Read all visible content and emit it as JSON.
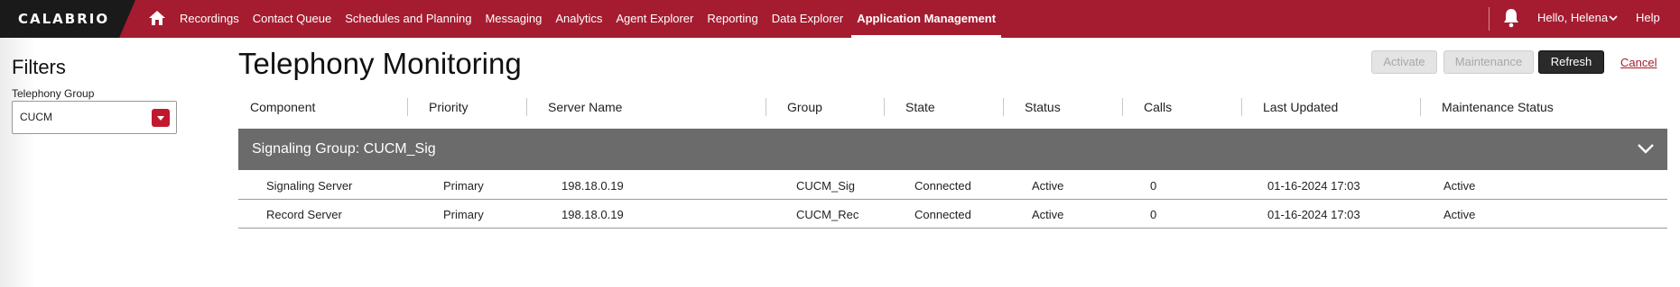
{
  "topbar": {
    "brand": "CALABRIO",
    "nav": [
      "Recordings",
      "Contact Queue",
      "Schedules and Planning",
      "Messaging",
      "Analytics",
      "Agent Explorer",
      "Reporting",
      "Data Explorer",
      "Application Management"
    ],
    "active_nav": "Application Management",
    "greeting": "Hello, Helena",
    "help": "Help",
    "colors": {
      "bar": "#a51c30",
      "brand_bg": "#1a1a1a"
    }
  },
  "sidebar": {
    "title": "Filters",
    "telephony_group_label": "Telephony Group",
    "telephony_group_value": "CUCM"
  },
  "main": {
    "title": "Telephony Monitoring",
    "buttons": {
      "activate": "Activate",
      "maintenance": "Maintenance",
      "refresh": "Refresh",
      "cancel": "Cancel"
    },
    "columns": [
      "Component",
      "Priority",
      "Server Name",
      "Group",
      "State",
      "Status",
      "Calls",
      "Last Updated",
      "Maintenance Status"
    ],
    "group": {
      "label": "Signaling Group: CUCM_Sig",
      "rows": [
        {
          "component": "Signaling Server",
          "priority": "Primary",
          "server": "198.18.0.19",
          "group": "CUCM_Sig",
          "state": "Connected",
          "status": "Active",
          "calls": "0",
          "updated": "01-16-2024 17:03",
          "maint": "Active"
        },
        {
          "component": "Record Server",
          "priority": "Primary",
          "server": "198.18.0.19",
          "group": "CUCM_Rec",
          "state": "Connected",
          "status": "Active",
          "calls": "0",
          "updated": "01-16-2024 17:03",
          "maint": "Active"
        }
      ]
    }
  }
}
